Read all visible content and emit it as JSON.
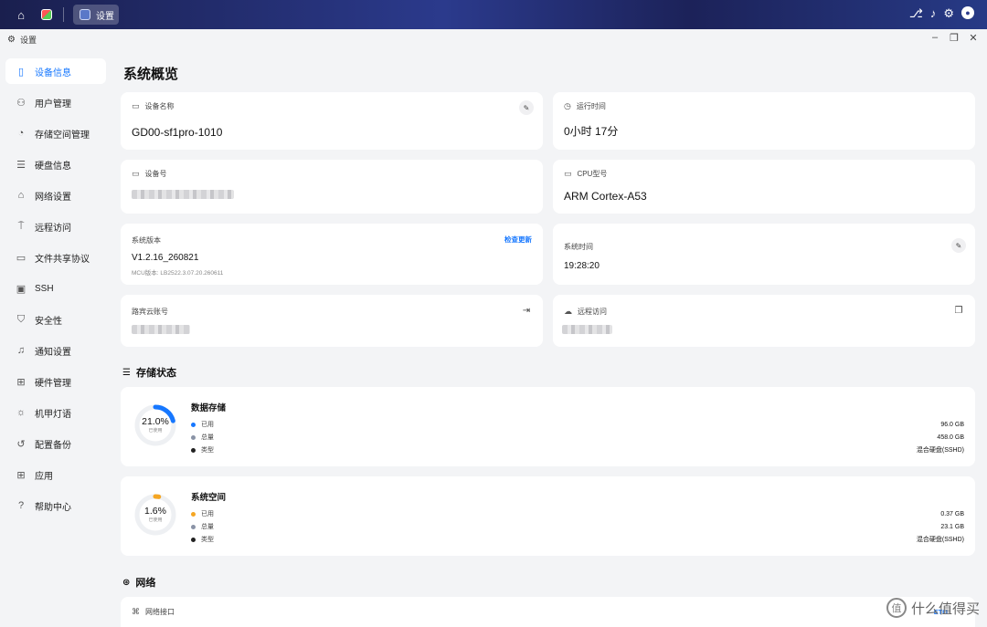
{
  "taskbar": {
    "task_label": "设置"
  },
  "window": {
    "title": "设置"
  },
  "sidebar": {
    "items": [
      {
        "label": "设备信息",
        "icon": "device-icon",
        "glyph": "▯"
      },
      {
        "label": "用户管理",
        "icon": "users-icon",
        "glyph": "⚇"
      },
      {
        "label": "存储空间管理",
        "icon": "storage-pie-icon",
        "glyph": "◔"
      },
      {
        "label": "硬盘信息",
        "icon": "disk-icon",
        "glyph": "☰"
      },
      {
        "label": "网络设置",
        "icon": "network-icon",
        "glyph": "⌂"
      },
      {
        "label": "远程访问",
        "icon": "remote-icon",
        "glyph": "⍑"
      },
      {
        "label": "文件共享协议",
        "icon": "folder-share-icon",
        "glyph": "▭"
      },
      {
        "label": "SSH",
        "icon": "terminal-icon",
        "glyph": "▣"
      },
      {
        "label": "安全性",
        "icon": "shield-icon",
        "glyph": "⛉"
      },
      {
        "label": "通知设置",
        "icon": "bell-icon",
        "glyph": "♫"
      },
      {
        "label": "硬件管理",
        "icon": "chip-icon",
        "glyph": "⊞"
      },
      {
        "label": "机甲灯语",
        "icon": "bulb-icon",
        "glyph": "☼"
      },
      {
        "label": "配置备份",
        "icon": "backup-icon",
        "glyph": "↺"
      },
      {
        "label": "应用",
        "icon": "apps-icon",
        "glyph": "⊞"
      },
      {
        "label": "帮助中心",
        "icon": "help-icon",
        "glyph": "?"
      }
    ]
  },
  "main": {
    "title": "系统概览",
    "cards": {
      "device_name": {
        "label": "设备名称",
        "value": "GD00-sf1pro-1010"
      },
      "uptime": {
        "label": "运行时间",
        "value": "0小时 17分"
      },
      "device_sn": {
        "label": "设备号"
      },
      "cpu": {
        "label": "CPU型号",
        "value": "ARM Cortex-A53"
      },
      "version": {
        "label": "系统版本",
        "value": "V1.2.16_260821",
        "mcu": "MCU版本: LB2522.3.07.20.260611",
        "link": "检查更新"
      },
      "system_time": {
        "label": "系统时间",
        "value": "19:28:20"
      },
      "cloud_account": {
        "label": "路宾云账号"
      },
      "remote": {
        "label": "远程访问"
      }
    },
    "storage_title": "存储状态",
    "storage": [
      {
        "name": "数据存储",
        "percent": "21.0%",
        "percent_sub": "已使用",
        "fraction": 0.21,
        "color": "#1677ff",
        "rows": [
          {
            "label": "已用",
            "value": "96.0 GB",
            "dot": "#1677ff"
          },
          {
            "label": "总量",
            "value": "458.0 GB",
            "dot": "#8a93a6"
          },
          {
            "label": "类型",
            "value": "混合硬盘(SSHD)",
            "dot": "#222"
          }
        ]
      },
      {
        "name": "系统空间",
        "percent": "1.6%",
        "percent_sub": "已使用",
        "fraction": 0.016,
        "color": "#f5a623",
        "rows": [
          {
            "label": "已用",
            "value": "0.37 GB",
            "dot": "#f5a623"
          },
          {
            "label": "总量",
            "value": "23.1 GB",
            "dot": "#8a93a6"
          },
          {
            "label": "类型",
            "value": "混合硬盘(SSHD)",
            "dot": "#222"
          }
        ]
      }
    ],
    "network_title": "网络",
    "network_card_label": "网络接口",
    "network_card_link": "ETO"
  },
  "watermark": "什么值得买"
}
